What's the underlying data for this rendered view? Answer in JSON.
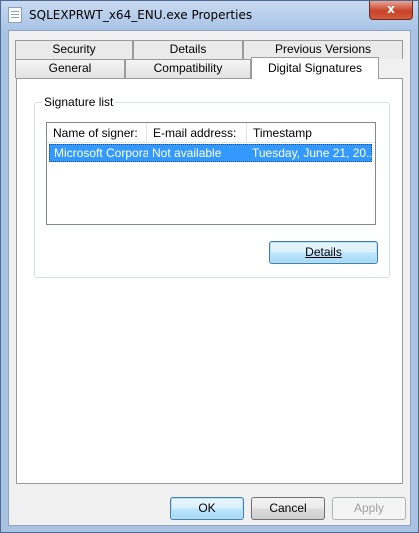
{
  "window": {
    "title": "SQLEXPRWT_x64_ENU.exe Properties",
    "close_glyph": "x"
  },
  "tabs": {
    "row1": [
      {
        "label": "Security"
      },
      {
        "label": "Details"
      },
      {
        "label": "Previous Versions"
      }
    ],
    "row2": [
      {
        "label": "General"
      },
      {
        "label": "Compatibility"
      },
      {
        "label": "Digital Signatures",
        "selected": true
      }
    ]
  },
  "signature_group": {
    "label": "Signature list",
    "columns": [
      "Name of signer:",
      "E-mail address:",
      "Timestamp"
    ],
    "rows": [
      {
        "name": "Microsoft Corpora...",
        "email": "Not available",
        "timestamp": "Tuesday, June 21, 20...",
        "selected": true
      }
    ],
    "details_button": "Details"
  },
  "footer": {
    "ok": "OK",
    "cancel": "Cancel",
    "apply": "Apply"
  },
  "colors": {
    "selection": "#3399ff",
    "title_bar": "#aac3e3",
    "close_button": "#c7432a"
  }
}
